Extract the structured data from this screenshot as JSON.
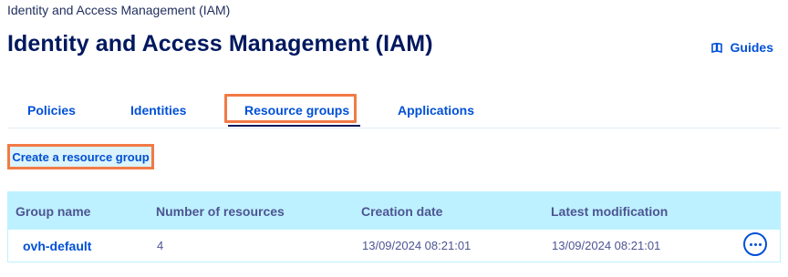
{
  "breadcrumb": "Identity and Access Management (IAM)",
  "page_title": "Identity and Access Management (IAM)",
  "guides_label": "Guides",
  "tabs": [
    {
      "label": "Policies"
    },
    {
      "label": "Identities"
    },
    {
      "label": "Resource groups",
      "active": true
    },
    {
      "label": "Applications"
    }
  ],
  "create_button_label": "Create a resource group",
  "table": {
    "columns": [
      "Group name",
      "Number of resources",
      "Creation date",
      "Latest modification"
    ],
    "rows": [
      {
        "group_name": "ovh-default",
        "resources": "4",
        "created": "13/09/2024 08:21:01",
        "modified": "13/09/2024 08:21:01"
      }
    ]
  },
  "colors": {
    "accent": "#0050d7",
    "title": "#00185e",
    "header_bg": "#bef1ff",
    "highlight": "#f27a46"
  },
  "icons": {
    "guides": "book-icon",
    "row_actions": "more-options-icon"
  }
}
